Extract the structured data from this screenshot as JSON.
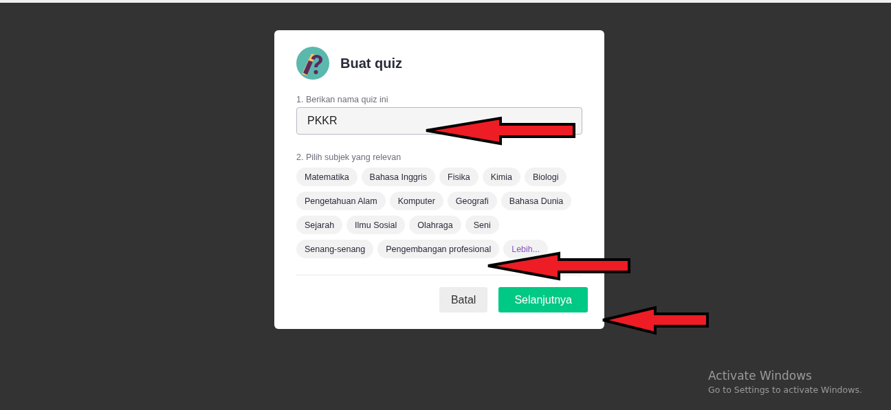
{
  "dialog": {
    "title": "Buat quiz",
    "name_field": {
      "label": "1. Berikan nama quiz ini",
      "value": "PKKR"
    },
    "subjects": {
      "label": "2. Pilih subjek yang relevan",
      "chips": [
        {
          "label": "Matematika",
          "kind": "subject"
        },
        {
          "label": "Bahasa Inggris",
          "kind": "subject"
        },
        {
          "label": "Fisika",
          "kind": "subject"
        },
        {
          "label": "Kimia",
          "kind": "subject"
        },
        {
          "label": "Biologi",
          "kind": "subject"
        },
        {
          "label": "Pengetahuan Alam",
          "kind": "subject"
        },
        {
          "label": "Komputer",
          "kind": "subject"
        },
        {
          "label": "Geografi",
          "kind": "subject"
        },
        {
          "label": "Bahasa Dunia",
          "kind": "subject"
        },
        {
          "label": "Sejarah",
          "kind": "subject"
        },
        {
          "label": "Ilmu Sosial",
          "kind": "subject"
        },
        {
          "label": "Olahraga",
          "kind": "subject"
        },
        {
          "label": "Seni",
          "kind": "subject"
        },
        {
          "label": "Senang-senang",
          "kind": "subject"
        },
        {
          "label": "Pengembangan profesional",
          "kind": "subject"
        },
        {
          "label": "Lebih...",
          "kind": "more"
        }
      ]
    },
    "buttons": [
      {
        "label": "Batal",
        "kind": "secondary"
      },
      {
        "label": "Selanjutnya",
        "kind": "primary"
      }
    ]
  },
  "annotations": [
    {
      "kind": "arrow"
    },
    {
      "kind": "arrow"
    },
    {
      "kind": "arrow"
    }
  ],
  "os_notice": {
    "title": "Activate Windows",
    "text": "Go to Settings to activate Windows."
  }
}
